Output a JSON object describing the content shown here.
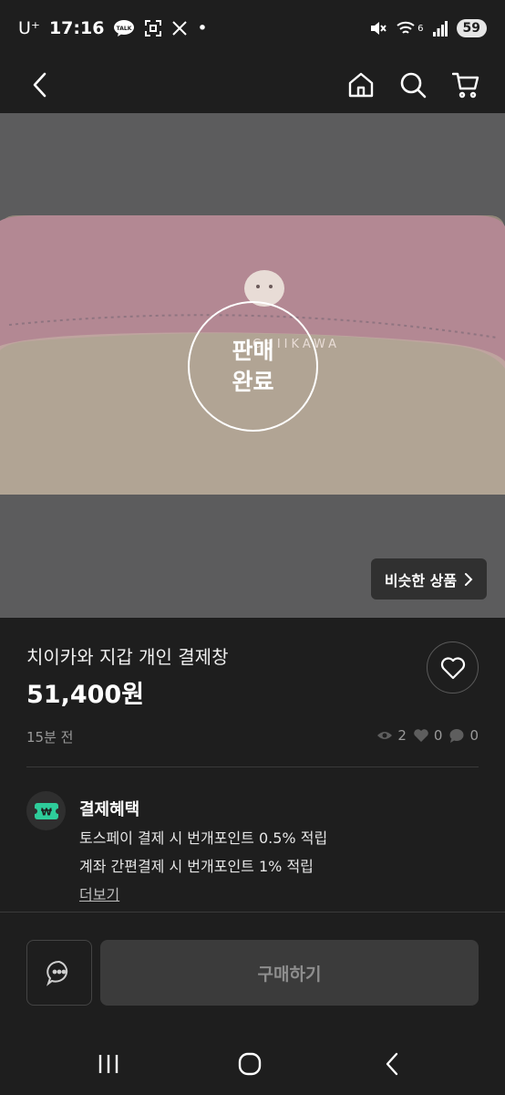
{
  "status_bar": {
    "carrier": "U⁺",
    "time": "17:16",
    "notif_icons": [
      "kakaotalk-icon",
      "screenshot-icon",
      "x-icon"
    ],
    "dot": "•",
    "network_sup": "6",
    "battery": "59"
  },
  "nav": {
    "icons": [
      "back-arrow-icon",
      "home-icon",
      "search-icon",
      "cart-icon"
    ]
  },
  "product": {
    "sold_line1": "판매",
    "sold_line2": "완료",
    "similar_label": "비슷한 상품",
    "title": "치이카와 지갑 개인 결제창",
    "price": "51,400원",
    "posted": "15분 전",
    "views": "2",
    "likes": "0",
    "chats": "0"
  },
  "benefit": {
    "title": "결제혜택",
    "line1": "토스페이 결제 시 번개포인트 0.5% 적립",
    "line2": "계좌 간편결제 시 번개포인트 1% 적립",
    "more": "더보기",
    "icon_label": "₩"
  },
  "bottom": {
    "buy_label": "구매하기"
  },
  "colors": {
    "background": "#1e1e1e",
    "wallet_pink": "#c78e9b",
    "wallet_cream": "#e5d8c3",
    "benefit_green": "#2ecc9a"
  }
}
